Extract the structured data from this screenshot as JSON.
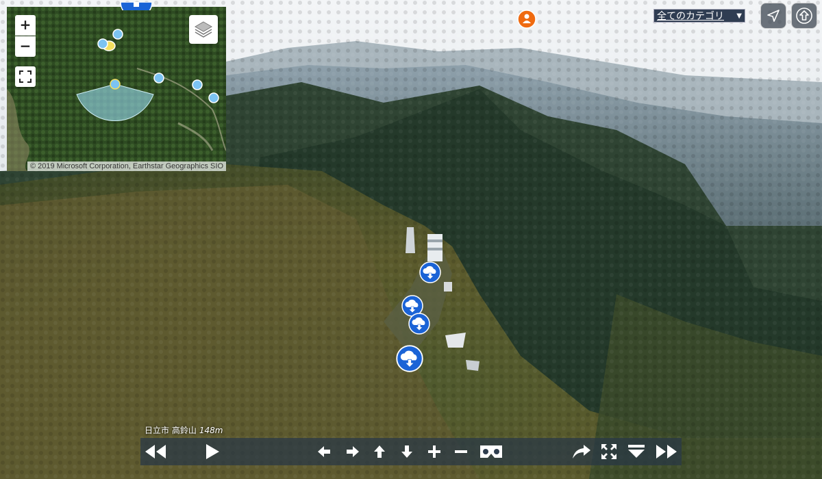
{
  "minimap": {
    "zoom_in_label": "+",
    "zoom_out_label": "−",
    "attribution": "© 2019 Microsoft Corporation, Earthstar Geographics SIO"
  },
  "header": {
    "category_label": "全てのカテゴリ",
    "category_arrow": "▼"
  },
  "location": {
    "name": "日立市 高鈴山",
    "elevation": "148m"
  },
  "colors": {
    "hotspot_blue": "#1a63d6",
    "person_orange": "#ef6a10",
    "toolbar_bg": "#28374a",
    "minimap_marker": "#7cc3f2",
    "view_cone": "#8fd0e0"
  },
  "icons": {
    "hotspots": [
      "cloud-download-icon",
      "cloud-download-icon",
      "cloud-download-icon",
      "cloud-download-icon"
    ],
    "toolbar": [
      "rewind-icon",
      "play-icon",
      "arrow-left-icon",
      "arrow-right-icon",
      "arrow-up-icon",
      "arrow-down-icon",
      "zoom-in-icon",
      "zoom-out-icon",
      "vr-goggles-icon",
      "share-icon",
      "fullscreen-icon",
      "menu-down-icon",
      "fast-forward-icon"
    ]
  }
}
